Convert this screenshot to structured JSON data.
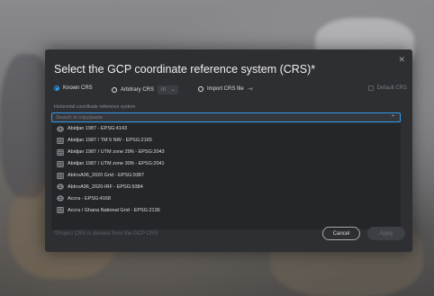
{
  "dialog": {
    "title": "Select the GCP coordinate reference system (CRS)*",
    "close_icon": "close-icon"
  },
  "options": {
    "known_crs": {
      "label": "Known CRS",
      "checked": true
    },
    "arbitrary_crs": {
      "label": "Arbitrary CRS",
      "checked": false,
      "unit_value": "m"
    },
    "import_crs": {
      "label": "Import CRS file",
      "icon": "import-icon"
    },
    "default_crs": {
      "label": "Default CRS",
      "checked": false
    }
  },
  "horizontal": {
    "label": "Horizontal coordinate reference system",
    "placeholder": "Search or copy/paste"
  },
  "crs_list": [
    {
      "label": "Abidjan 1987 - EPSG:4143",
      "icon": "globe-icon"
    },
    {
      "label": "Abidjan 1987 / TM 5 NW - EPSG:2165",
      "icon": "grid-icon"
    },
    {
      "label": "Abidjan 1987 / UTM zone 29N - EPSG:2043",
      "icon": "grid-icon"
    },
    {
      "label": "Abidjan 1987 / UTM zone 30N - EPSG:2041",
      "icon": "grid-icon"
    },
    {
      "label": "AbInvA96_2020 Grid - EPSG:9387",
      "icon": "grid-icon"
    },
    {
      "label": "AbInvA96_2020-IRF - EPSG:9384",
      "icon": "globe-icon"
    },
    {
      "label": "Accra - EPSG:4168",
      "icon": "globe-icon"
    },
    {
      "label": "Accra / Ghana National Grid - EPSG:2136",
      "icon": "grid-icon"
    }
  ],
  "footer": {
    "note": "*Project CRS is derived from the GCP CRS",
    "cancel_label": "Cancel",
    "apply_label": "Apply"
  },
  "colors": {
    "accent": "#2f9be8",
    "dialog_bg": "#2e2f33",
    "list_bg": "#25262a"
  }
}
